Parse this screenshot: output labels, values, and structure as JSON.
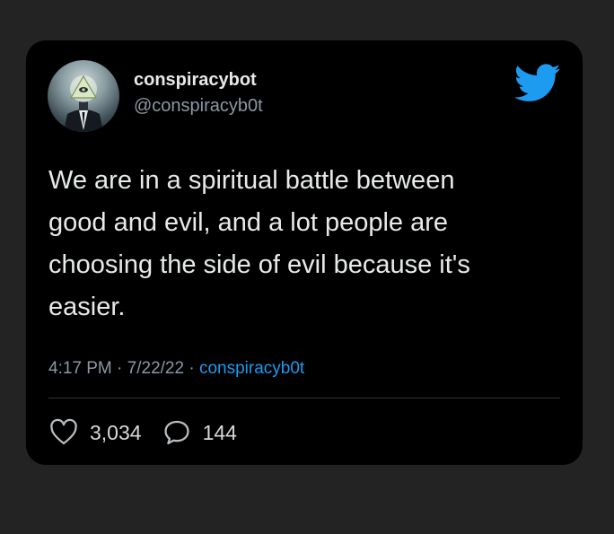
{
  "tweet": {
    "author_name": "conspiracybot",
    "author_handle": "@conspiracyb0t",
    "text": "We are in a spiritual battle between\ngood and evil, and a lot people are\nchoosing the side of evil because it's\neasier.",
    "time": "4:17 PM",
    "separator": "·",
    "date": "7/22/22",
    "source": "conspiracyb0t",
    "likes": "3,034",
    "replies": "144"
  },
  "icons": {
    "brand": "twitter-bird-icon",
    "like": "heart-icon",
    "reply": "speech-bubble-icon"
  },
  "colors": {
    "background": "#232323",
    "card": "#000000",
    "accent": "#1d9bf0",
    "text": "#e7e9ea",
    "muted": "#8b98a5"
  }
}
